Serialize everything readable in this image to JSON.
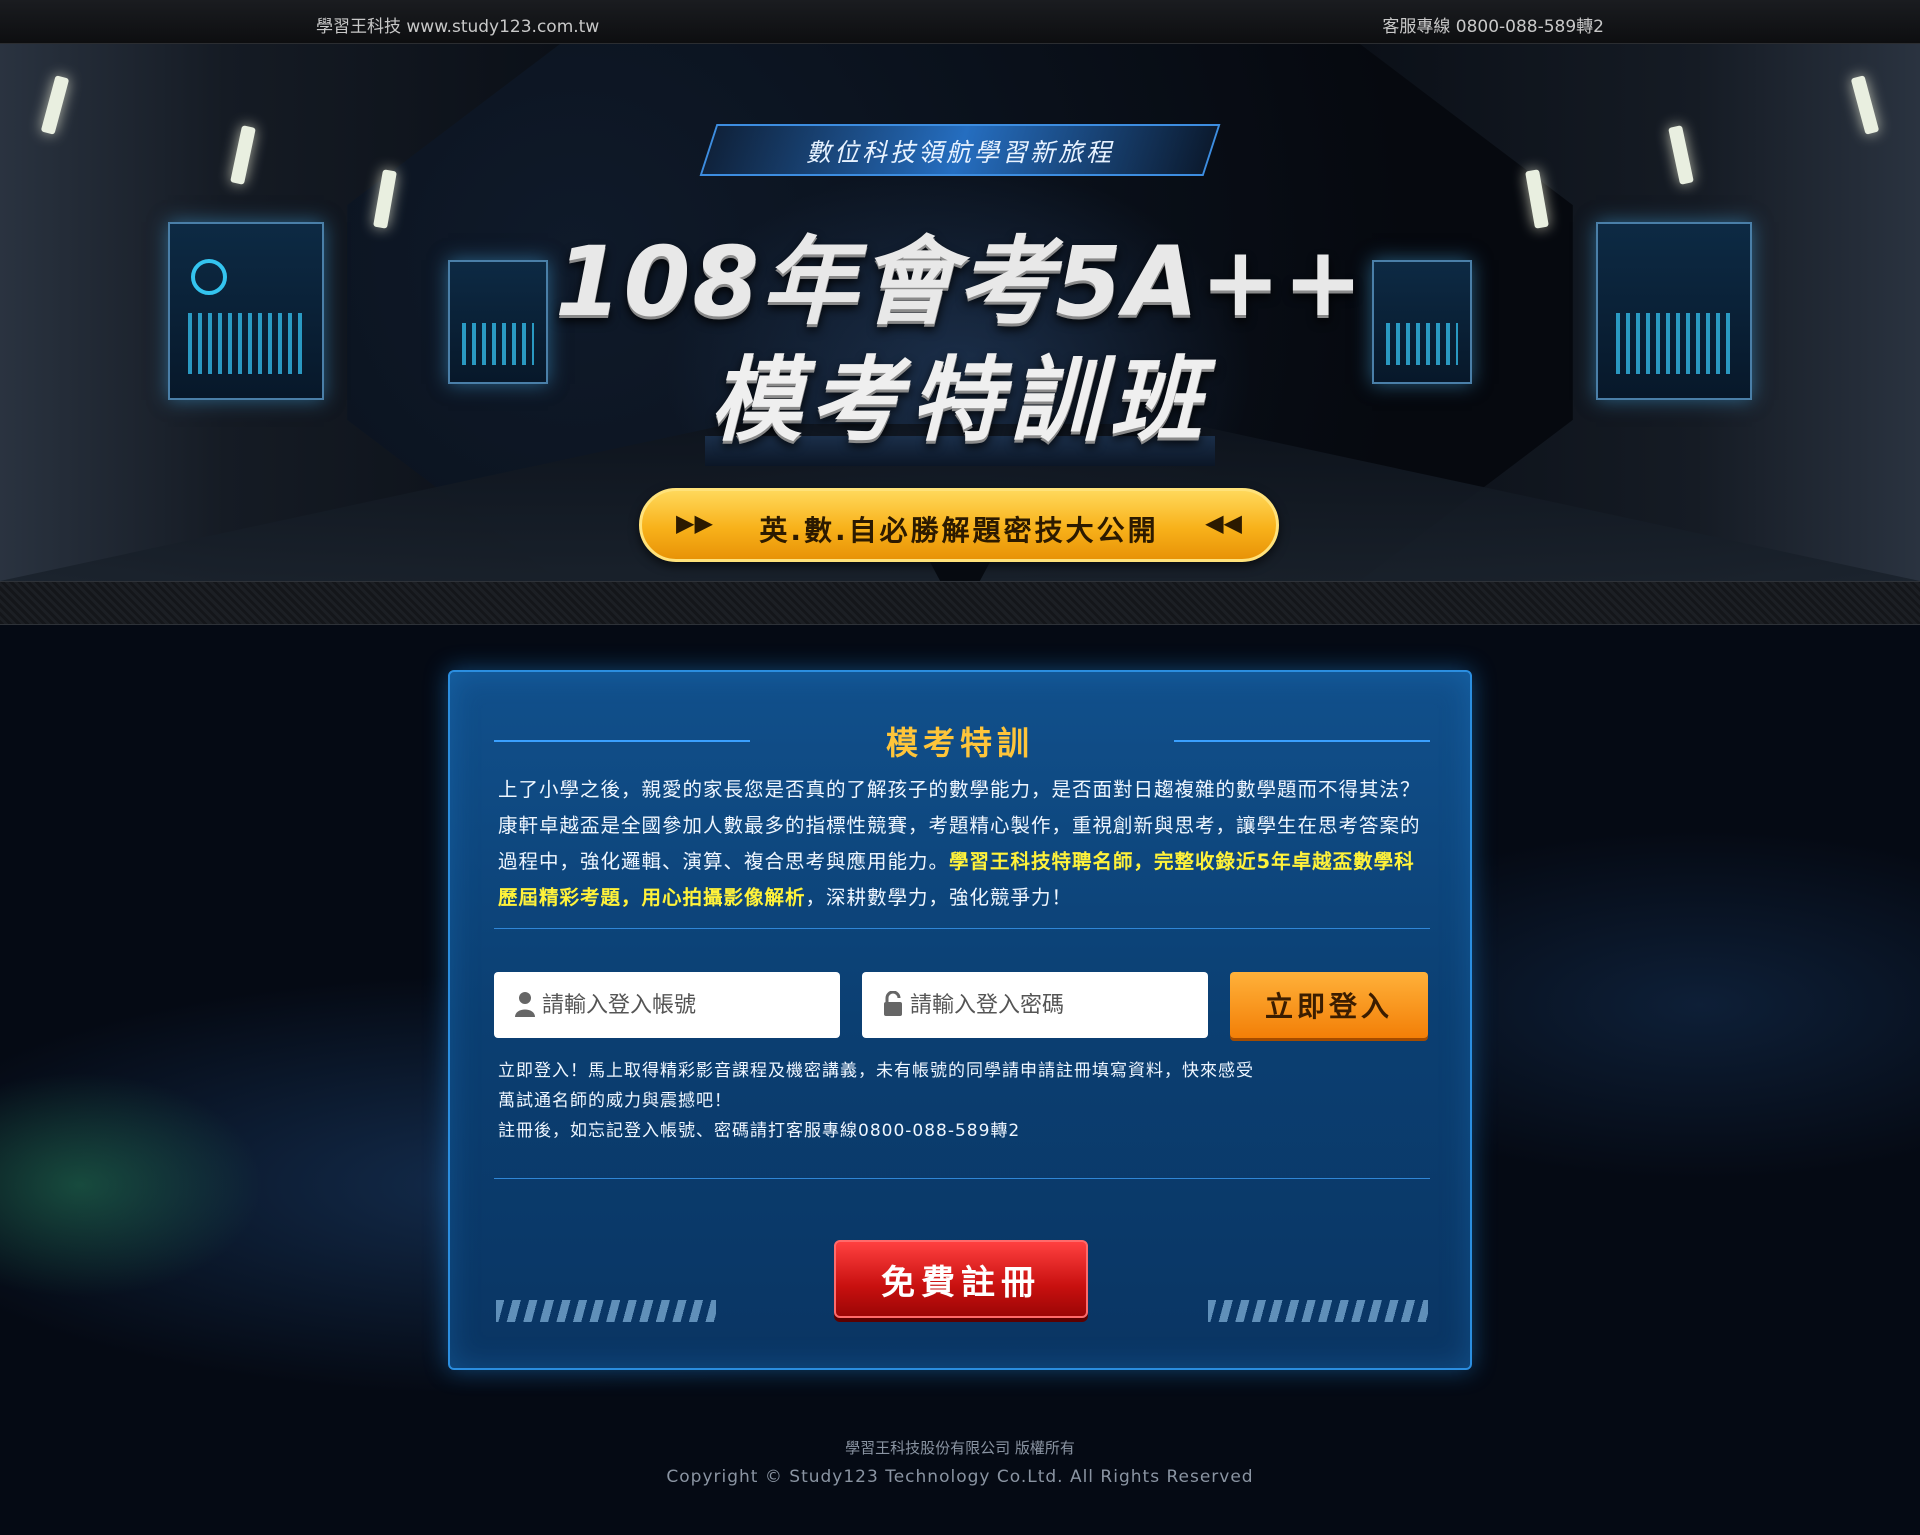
{
  "topbar": {
    "brand": "學習王科技 www.study123.com.tw",
    "phone": "客服專線 0800-088-589轉2"
  },
  "banner": {
    "slogan": "數位科技領航學習新旅程",
    "title_line1": "108年會考5A++",
    "title_line2": "模考特訓班",
    "cta_label": "英.數.自必勝解題密技大公開",
    "cta_left_icon": "double-play-right",
    "cta_right_icon": "double-play-left"
  },
  "panel": {
    "title": "模考特訓",
    "intro": "上了小學之後，親愛的家長您是否真的了解孩子的數學能力，是否面對日趨複雜的數學題而不得其法？康軒卓越盃是全國參加人數最多的指標性競賽，考題精心製作，重視創新與思考，讓學生在思考答案的過程中，強化邏輯、演算、複合思考與應用能力。",
    "intro_highlight": "學習王科技特聘名師，完整收錄近5年卓越盃數學科歷屆精彩考題，用心拍攝影像解析",
    "intro_tail": "，深耕數學力，強化競爭力！",
    "login": {
      "username_placeholder": "請輸入登入帳號",
      "username_value": "",
      "username_icon": "user-icon",
      "password_placeholder": "請輸入登入密碼",
      "password_value": "",
      "password_icon": "lock-icon",
      "button": "立即登入"
    },
    "note_line1": "立即登入！馬上取得精彩影音課程及機密講義，未有帳號的同學請申請註冊填寫資料，快來感受萬試通名師的威力與震撼吧！",
    "note_line2": "註冊後，如忘記登入帳號、密碼請打客服專線0800-088-589轉2",
    "register_button": "免費註冊"
  },
  "footer": {
    "company": "學習王科技股份有限公司 版權所有",
    "copyright": "Copyright © Study123 Technology Co.Ltd. All Rights Reserved"
  },
  "colors": {
    "accent_gold": "#ffc53a",
    "highlight_yellow": "#fff23a",
    "panel_blue": "#0b3f72",
    "login_orange": "#f37f07",
    "register_red": "#c8100f"
  }
}
